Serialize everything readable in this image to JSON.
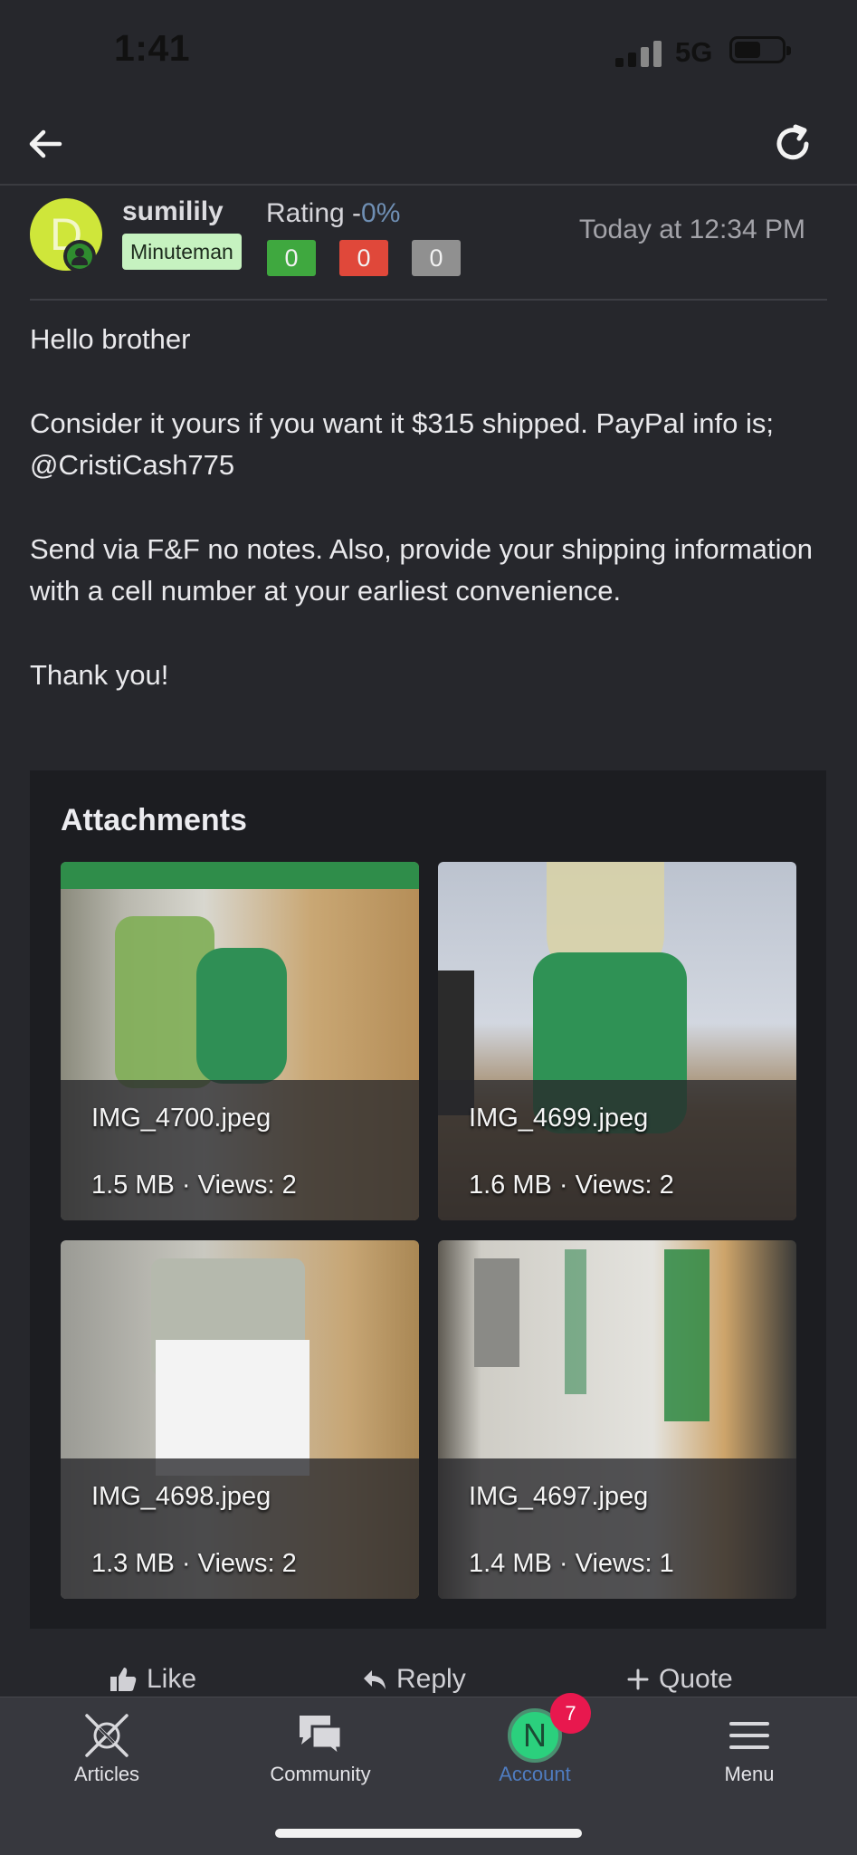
{
  "status_bar": {
    "time": "1:41",
    "network": "5G"
  },
  "post": {
    "author": {
      "username": "sumilily",
      "avatar_letter": "D",
      "group": "Minuteman"
    },
    "rating": {
      "label": "Rating -",
      "percent": "0%",
      "positive": "0",
      "negative": "0",
      "neutral": "0"
    },
    "timestamp": "Today at 12:34 PM",
    "body": {
      "p1": "Hello brother",
      "p2": "Consider it yours if you want it $315 shipped. PayPal info is; @CristiCash775",
      "p3": "Send via F&F no notes. Also, provide your shipping information with a cell number at your earliest convenience.",
      "p4": "Thank you!"
    },
    "attachments": {
      "title": "Attachments",
      "items": [
        {
          "filename": "IMG_4700.jpeg",
          "meta": "1.5 MB · Views: 2"
        },
        {
          "filename": "IMG_4699.jpeg",
          "meta": "1.6 MB · Views: 2"
        },
        {
          "filename": "IMG_4698.jpeg",
          "meta": "1.3 MB · Views: 2"
        },
        {
          "filename": "IMG_4697.jpeg",
          "meta": "1.4 MB · Views: 1"
        }
      ]
    },
    "actions": {
      "like": "Like",
      "reply": "Reply",
      "quote": "Quote"
    }
  },
  "tabbar": {
    "articles": "Articles",
    "community": "Community",
    "account": "Account",
    "account_letter": "N",
    "account_badge": "7",
    "menu": "Menu"
  },
  "icons": [
    "back-arrow-icon",
    "refresh-icon",
    "thumbs-up-icon",
    "reply-icon",
    "plus-icon",
    "articles-icon",
    "community-icon",
    "menu-icon"
  ],
  "colors": {
    "background": "#26272c",
    "positive": "#3fa83f",
    "negative": "#e0483a",
    "neutral": "#909090",
    "badge": "#e8184e",
    "account_active": "#4f7cc0"
  }
}
